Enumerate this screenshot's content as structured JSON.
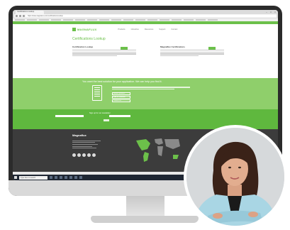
{
  "browser": {
    "tab_title": "Certifications Lookup",
    "url": "https://www.nagnatux.com/certifications-lookup",
    "window_controls": [
      "–",
      "□",
      "×"
    ]
  },
  "site": {
    "logo": "MAGNAFLUX",
    "nav": [
      "Products",
      "Industries",
      "Resources",
      "Support",
      "Contact"
    ],
    "page_title": "Certifications Lookup",
    "left_col_title": "Certification Lookup",
    "right_col_title": "Magnaflux Certifications",
    "promo_title": "You want the best solution for your application. We can help you find it.",
    "promo_buttons": [
      "Browse products",
      "Find a Distributor",
      "Contact Us"
    ],
    "signup_label": "Sign up for our newsletter",
    "footer_brand": "Magnaflux",
    "social_icons": [
      "facebook-icon",
      "twitter-icon",
      "linkedin-icon",
      "youtube-icon",
      "instagram-icon"
    ]
  },
  "taskbar": {
    "search_placeholder": "Type here to search"
  },
  "colors": {
    "brand_green": "#6cc04a",
    "promo_green": "#8fcf6b",
    "footer": "#3c3c3c"
  }
}
